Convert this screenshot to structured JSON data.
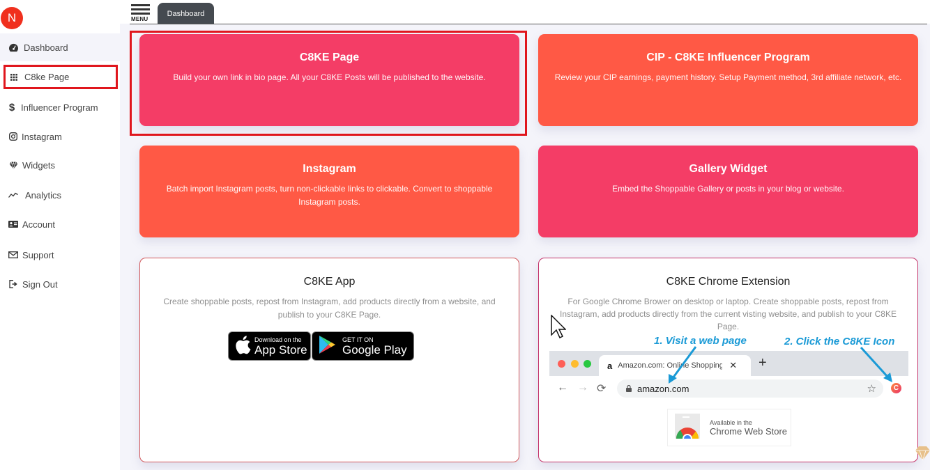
{
  "sidebar": {
    "avatar_letter": "N",
    "items": [
      {
        "label": "Dashboard",
        "icon": "dashboard-gauge-icon"
      },
      {
        "label": "C8ke Page",
        "icon": "grid-icon"
      },
      {
        "label": "Influencer Program",
        "icon": "dollar-icon"
      },
      {
        "label": "Instagram",
        "icon": "instagram-icon"
      },
      {
        "label": "Widgets",
        "icon": "diamond-icon"
      },
      {
        "label": "Analytics",
        "icon": "chart-line-icon"
      },
      {
        "label": "Account",
        "icon": "id-card-icon"
      },
      {
        "label": "Support",
        "icon": "envelope-icon"
      },
      {
        "label": "Sign Out",
        "icon": "sign-out-icon"
      }
    ]
  },
  "header": {
    "menu_label": "MENU",
    "tab_label": "Dashboard"
  },
  "cards": [
    {
      "title": "C8KE Page",
      "description": "Build your own link in bio page. All your C8KE Posts will be published to the website.",
      "color": "#f43d66"
    },
    {
      "title": "CIP - C8KE Influencer Program",
      "description": "Review your CIP earnings, payment history. Setup Payment method, 3rd affiliate network, etc.",
      "color": "#ff5945"
    },
    {
      "title": "Instagram",
      "description": "Batch import Instagram posts, turn non-clickable links to clickable. Convert to shoppable Instagram posts.",
      "color": "#ff5945"
    },
    {
      "title": "Gallery Widget",
      "description": "Embed the Shoppable Gallery or posts in your blog or website.",
      "color": "#f43d66"
    },
    {
      "title": "C8KE App",
      "description": "Create shoppable posts, repost from Instagram, add products directly from a website, and publish to your C8KE Page."
    },
    {
      "title": "C8KE Chrome Extension",
      "description": "For Google Chrome Brower on desktop or laptop. Create shoppable posts, repost from Instagram, add products directly from the current visting website, and publish to your C8KE Page."
    }
  ],
  "app_badges": {
    "apple_small": "Download on the",
    "apple_big": "App Store",
    "google_small": "GET IT ON",
    "google_big": "Google Play"
  },
  "chrome_illustration": {
    "step1": "1. Visit a web page",
    "step2": "2. Click the C8KE Icon",
    "tab_title": "Amazon.com: Online Shopping",
    "url": "amazon.com",
    "cws_small": "Available in the",
    "cws_big": "Chrome Web Store"
  },
  "colors": {
    "pink": "#f43d66",
    "orange": "#ff5945",
    "highlight_red": "#e0161d",
    "annotation_blue": "#1a9ad6"
  }
}
